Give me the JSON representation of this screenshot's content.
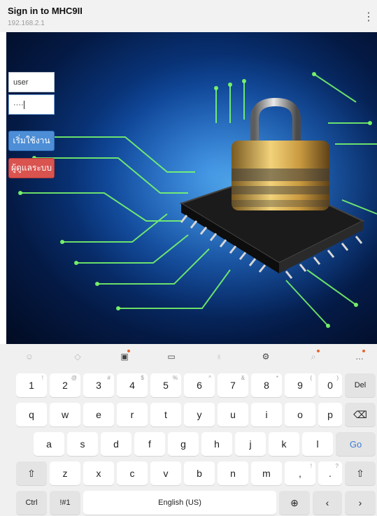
{
  "browser": {
    "title": "Sign in to MHC9II",
    "address": "192.168.2.1",
    "menu_icon": "more-vertical-icon"
  },
  "login": {
    "username_value": "user",
    "password_value": "····",
    "start_button": "เริ่มใช้งาน",
    "admin_button": "ผู้ดูแลระบบ"
  },
  "keyboard": {
    "toolbar_icons": [
      "emoji-icon",
      "sticker-icon",
      "clipboard-icon",
      "keyboard-icon",
      "mic-icon",
      "settings-icon",
      "search-icon",
      "more-icon"
    ],
    "row1": [
      {
        "k": "1",
        "s": "!"
      },
      {
        "k": "2",
        "s": "@"
      },
      {
        "k": "3",
        "s": "#"
      },
      {
        "k": "4",
        "s": "$"
      },
      {
        "k": "5",
        "s": "%"
      },
      {
        "k": "6",
        "s": "^"
      },
      {
        "k": "7",
        "s": "&"
      },
      {
        "k": "8",
        "s": "*"
      },
      {
        "k": "9",
        "s": "("
      },
      {
        "k": "0",
        "s": ")"
      }
    ],
    "del_label": "Del",
    "row2": [
      "q",
      "w",
      "e",
      "r",
      "t",
      "y",
      "u",
      "i",
      "o",
      "p"
    ],
    "row3": [
      "a",
      "s",
      "d",
      "f",
      "g",
      "h",
      "j",
      "k",
      "l"
    ],
    "go_label": "Go",
    "row4": [
      "z",
      "x",
      "c",
      "v",
      "b",
      "n",
      "m"
    ],
    "comma": {
      "k": ",",
      "s": "!"
    },
    "period": {
      "k": ".",
      "s": "?"
    },
    "ctrl_label": "Ctrl",
    "sym_label": "!#1",
    "space_label": "English (US)",
    "accent_color": "#3a7bd5",
    "dot_color": "#e8652d"
  }
}
